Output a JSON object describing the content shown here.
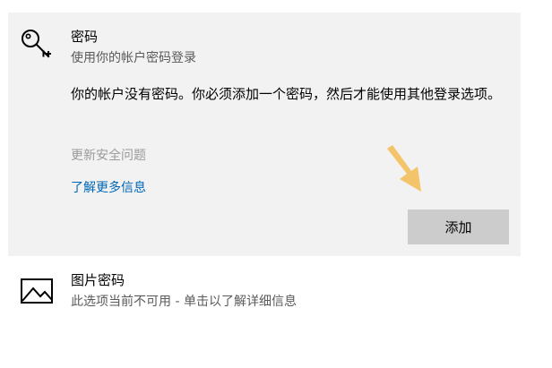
{
  "password": {
    "icon": "key-icon",
    "title": "密码",
    "subtitle": "使用你的帐户密码登录",
    "message": "你的帐户没有密码。你必须添加一个密码，然后才能使用其他登录选项。",
    "update_security_link": "更新安全问题",
    "learn_more_link": "了解更多信息",
    "add_button": "添加"
  },
  "picture_password": {
    "icon": "picture-icon",
    "title": "图片密码",
    "subtitle": "此选项当前不可用 - 单击以了解详细信息"
  },
  "colors": {
    "panel_bg": "#f2f2f2",
    "link": "#0067b8",
    "disabled_text": "#9a9a9a",
    "button_bg": "#cccccc",
    "annotation_arrow": "#f4c46a"
  }
}
